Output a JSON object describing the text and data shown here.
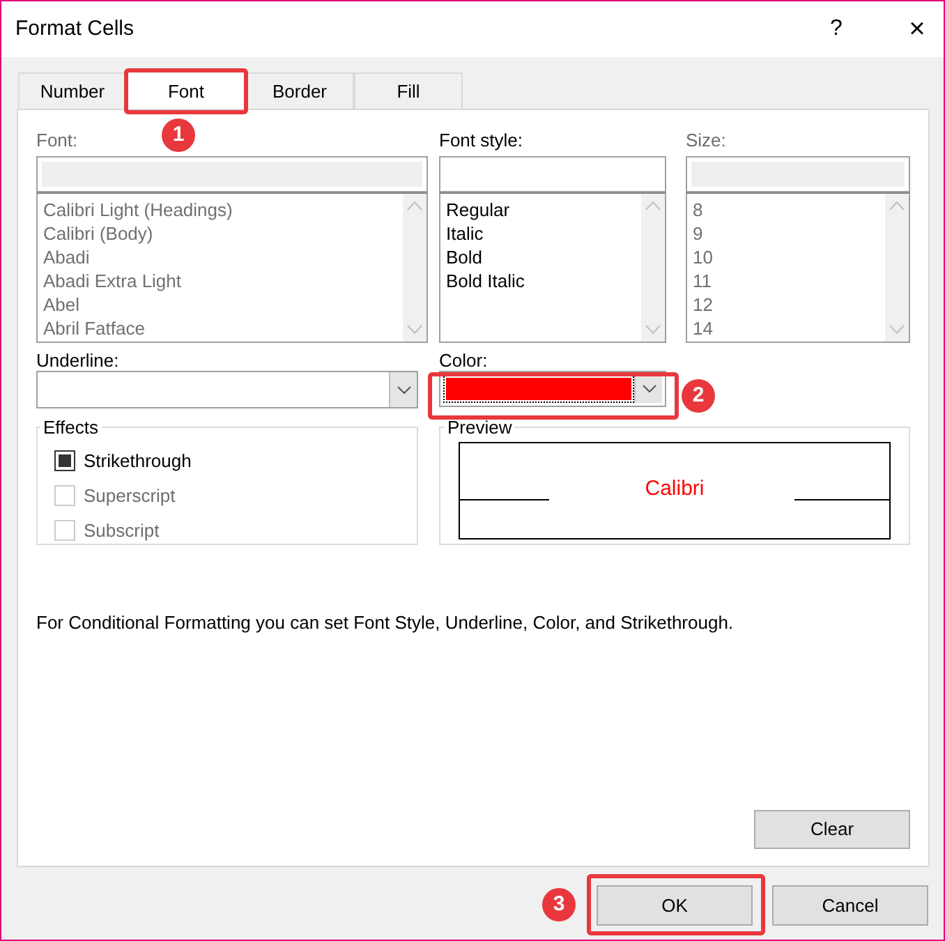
{
  "window": {
    "title": "Format Cells",
    "help": "?",
    "close": "×"
  },
  "tabs": [
    {
      "label": "Number",
      "selected": false
    },
    {
      "label": "Font",
      "selected": true
    },
    {
      "label": "Border",
      "selected": false
    },
    {
      "label": "Fill",
      "selected": false
    }
  ],
  "font": {
    "label": "Font:",
    "disabled": true,
    "items": [
      "Calibri Light (Headings)",
      "Calibri (Body)",
      "Abadi",
      "Abadi Extra Light",
      "Abel",
      "Abril Fatface"
    ]
  },
  "font_style": {
    "label": "Font style:",
    "disabled": false,
    "items": [
      "Regular",
      "Italic",
      "Bold",
      "Bold Italic"
    ]
  },
  "size": {
    "label": "Size:",
    "disabled": true,
    "items": [
      "8",
      "9",
      "10",
      "11",
      "12",
      "14"
    ]
  },
  "underline": {
    "label": "Underline:"
  },
  "color": {
    "label": "Color:",
    "color": "#ff0000"
  },
  "effects": {
    "title": "Effects",
    "options": [
      {
        "label": "Strikethrough",
        "checked": true,
        "disabled": false
      },
      {
        "label": "Superscript",
        "checked": false,
        "disabled": true
      },
      {
        "label": "Subscript",
        "checked": false,
        "disabled": true
      }
    ]
  },
  "preview": {
    "title": "Preview",
    "sample": "Calibri"
  },
  "note": "For Conditional Formatting you can set Font Style, Underline, Color, and Strikethrough.",
  "buttons": {
    "clear": "Clear",
    "ok": "OK",
    "cancel": "Cancel"
  },
  "callouts": [
    {
      "number": "1",
      "kind": "tab"
    },
    {
      "number": "2",
      "kind": "color"
    },
    {
      "number": "3",
      "kind": "ok"
    }
  ]
}
